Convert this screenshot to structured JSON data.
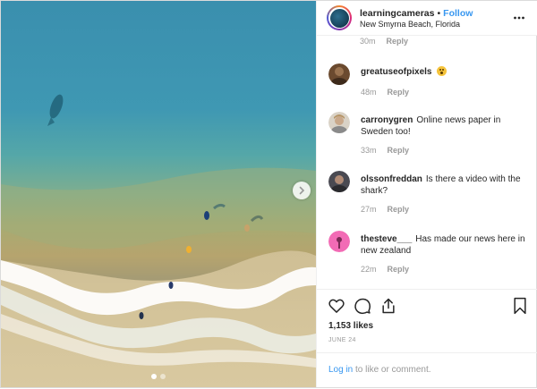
{
  "header": {
    "username": "learningcameras",
    "separator": "•",
    "follow_label": "Follow",
    "location": "New Smyrna Beach, Florida",
    "more_icon": "more-dots-icon"
  },
  "previous_comment_partial": {
    "time": "30m",
    "reply_label": "Reply"
  },
  "comments": [
    {
      "username": "greatuseofpixels",
      "text": "",
      "emoji": "hushed-face-emoji",
      "time": "48m",
      "reply_label": "Reply"
    },
    {
      "username": "carronygren",
      "text": "Online news paper in Sweden too!",
      "time": "33m",
      "reply_label": "Reply"
    },
    {
      "username": "olssonfreddan",
      "text": "Is there a video with the shark?",
      "time": "27m",
      "reply_label": "Reply"
    },
    {
      "username": "thesteve___",
      "text": "Has made our news here in new zealand",
      "time": "22m",
      "reply_label": "Reply"
    }
  ],
  "actions": {
    "like_icon": "heart-icon",
    "comment_icon": "comment-bubble-icon",
    "share_icon": "share-icon",
    "save_icon": "bookmark-icon"
  },
  "likes": "1,153 likes",
  "date": "JUNE 24",
  "footer": {
    "login_label": "Log in",
    "rest": "to like or comment."
  },
  "carousel": {
    "dot_count": 2,
    "active_index": 0,
    "next_icon": "chevron-right-icon"
  },
  "colors": {
    "link": "#3897f0",
    "text": "#262626",
    "muted": "#999999",
    "water": "#2b8fb0",
    "sand": "#c9b27a"
  }
}
